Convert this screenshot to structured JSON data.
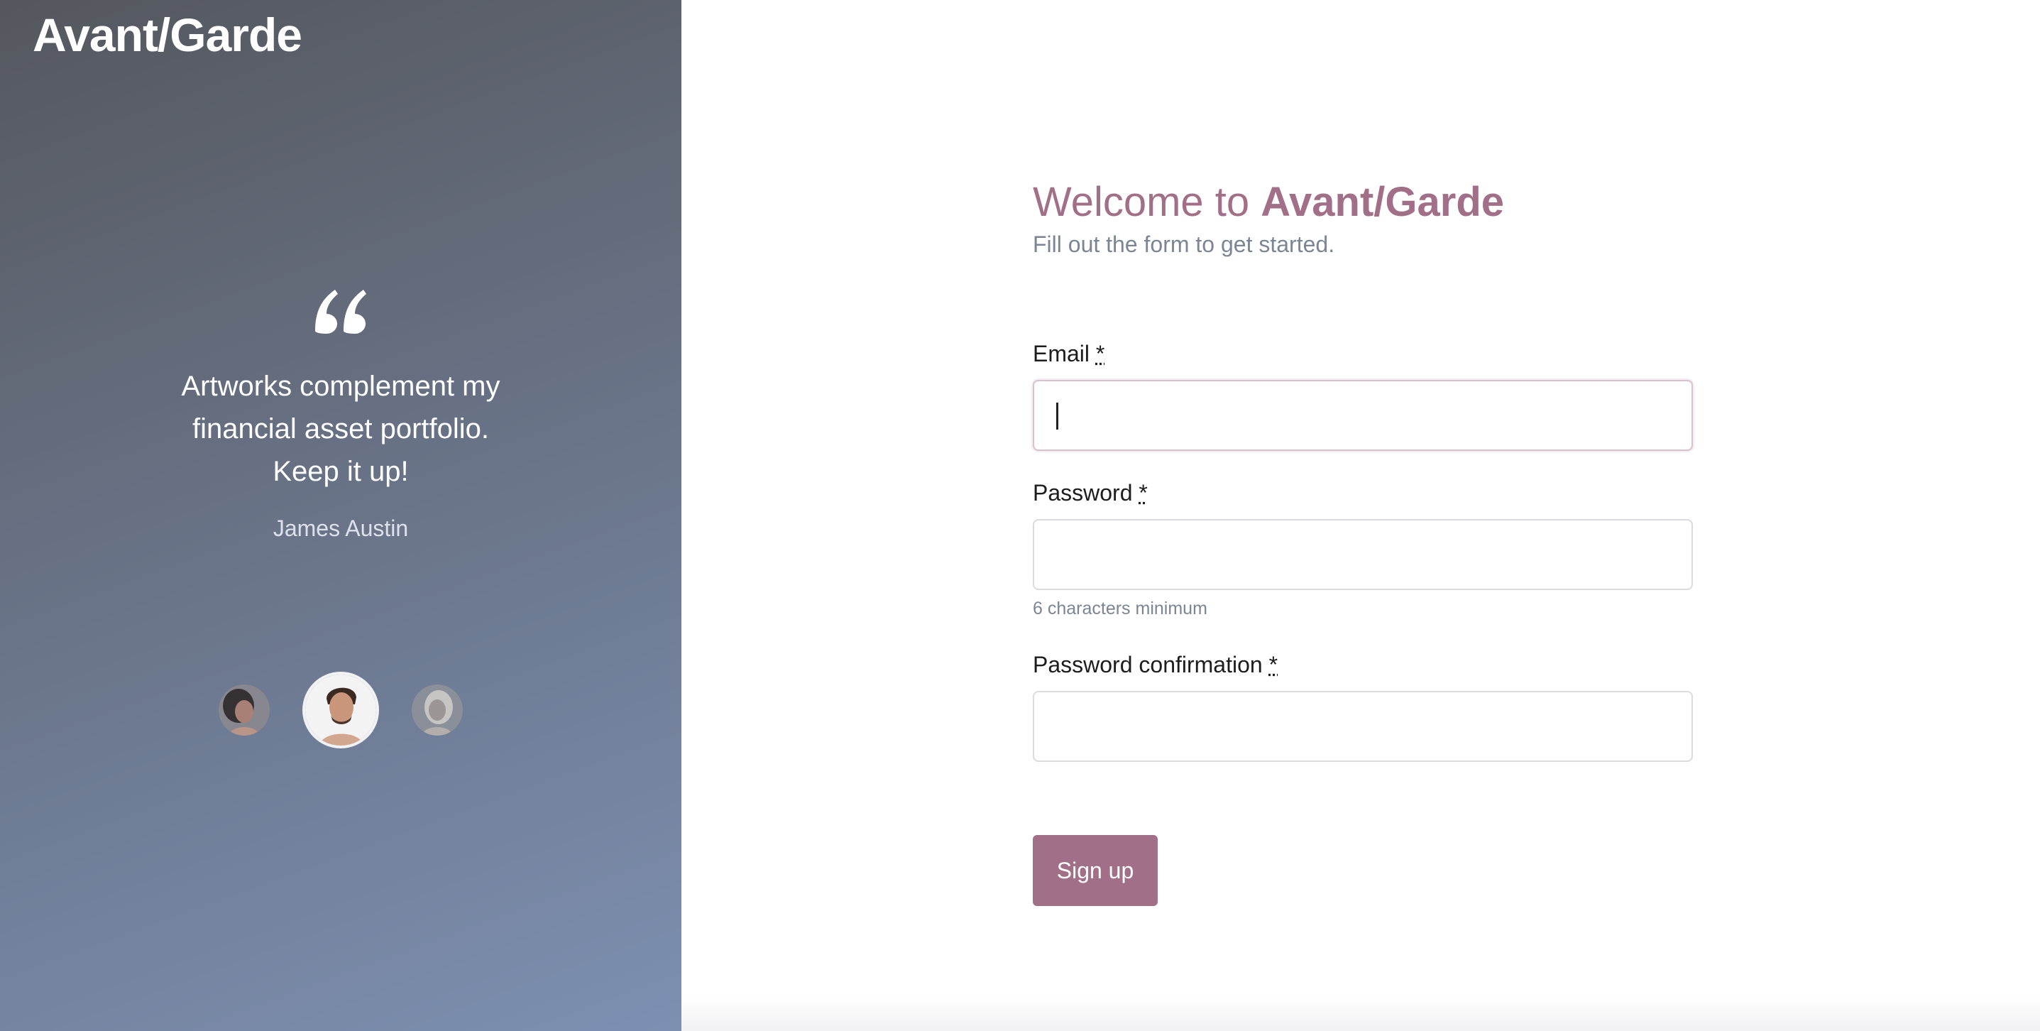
{
  "brand": {
    "name": "Avant/Garde"
  },
  "testimonial": {
    "quote": "Artworks complement my financial asset portfolio. Keep it up!",
    "author": "James Austin",
    "icon": "quote-icon",
    "avatars": [
      {
        "name": "avatar-woman-1",
        "active": false
      },
      {
        "name": "avatar-james-austin",
        "active": true
      },
      {
        "name": "avatar-woman-2",
        "active": false
      }
    ]
  },
  "form": {
    "title_prefix": "Welcome to",
    "title_brand": "Avant/Garde",
    "subtitle": "Fill out the form to get started.",
    "email": {
      "label": "Email",
      "required_mark": "*",
      "value": ""
    },
    "password": {
      "label": "Password",
      "required_mark": "*",
      "value": "",
      "hint": "6 characters minimum"
    },
    "password_confirmation": {
      "label": "Password confirmation",
      "required_mark": "*",
      "value": ""
    },
    "submit_label": "Sign up"
  },
  "colors": {
    "accent": "#a26f88",
    "muted_text": "#7b8594",
    "panel_gradient_start": "#54575d",
    "panel_gradient_end": "#7d90b1"
  }
}
